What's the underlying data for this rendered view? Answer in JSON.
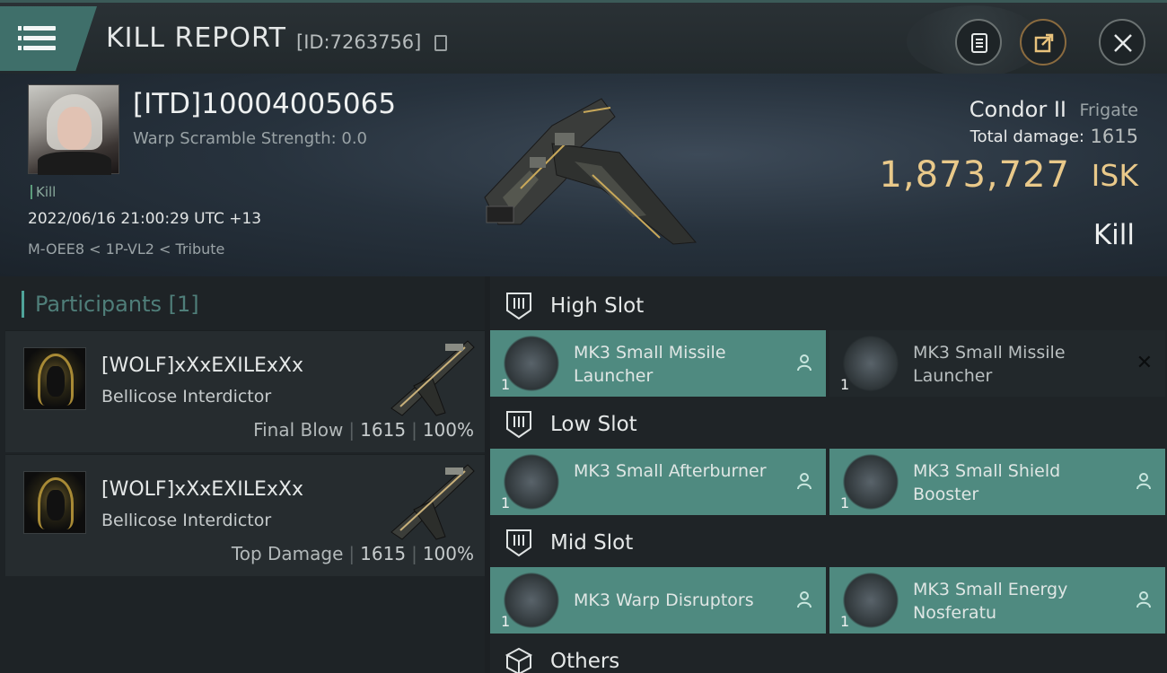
{
  "header": {
    "title": "KILL REPORT",
    "report_id": "[ID:7263756]"
  },
  "victim": {
    "name": "[ITD]10004005065",
    "warp_scramble": "Warp Scramble Strength: 0.0",
    "kill_tag": "Kill",
    "time": "2022/06/16 21:00:29 UTC +13",
    "location": "M-OEE8 < 1P-VL2 < Tribute",
    "ship_name": "Condor II",
    "ship_class": "Frigate",
    "damage_label": "Total damage:",
    "damage_value": "1615",
    "isk_value": "1,873,727",
    "isk_label": "ISK",
    "outcome": "Kill"
  },
  "participants": {
    "title": "Participants",
    "count": "[1]",
    "rows": [
      {
        "name": "[WOLF]xXxEXILExXx",
        "ship": "Bellicose Interdictor",
        "label": "Final Blow",
        "damage": "1615",
        "percent": "100%"
      },
      {
        "name": "[WOLF]xXxEXILExXx",
        "ship": "Bellicose Interdictor",
        "label": "Top Damage",
        "damage": "1615",
        "percent": "100%"
      }
    ]
  },
  "slots": {
    "high": {
      "title": "High Slot",
      "items": [
        {
          "name": "MK3 Small Missile Launcher",
          "qty": "1",
          "state": "dropped"
        },
        {
          "name": "MK3 Small Missile Launcher",
          "qty": "1",
          "state": "destroyed"
        }
      ]
    },
    "low": {
      "title": "Low Slot",
      "items": [
        {
          "name": "MK3 Small Afterburner",
          "qty": "1",
          "state": "dropped"
        },
        {
          "name": "MK3 Small Shield Booster",
          "qty": "1",
          "state": "dropped"
        }
      ]
    },
    "mid": {
      "title": "Mid Slot",
      "items": [
        {
          "name": "MK3 Warp Disruptors",
          "qty": "1",
          "state": "dropped"
        },
        {
          "name": "MK3 Small Energy Nosferatu",
          "qty": "1",
          "state": "dropped"
        }
      ]
    },
    "others": {
      "title": "Others"
    }
  },
  "icons": {
    "menu": "menu-icon",
    "copy": "copy-icon",
    "clipboard": "clipboard-icon",
    "share": "share-icon",
    "close": "close-icon",
    "slot": "slot-icon",
    "person": "person-icon",
    "box": "box-icon",
    "x": "x-icon"
  },
  "colors": {
    "accent_teal": "#4f8a80",
    "isk_gold": "#e9c98a",
    "participants_title": "#4f7e79"
  }
}
